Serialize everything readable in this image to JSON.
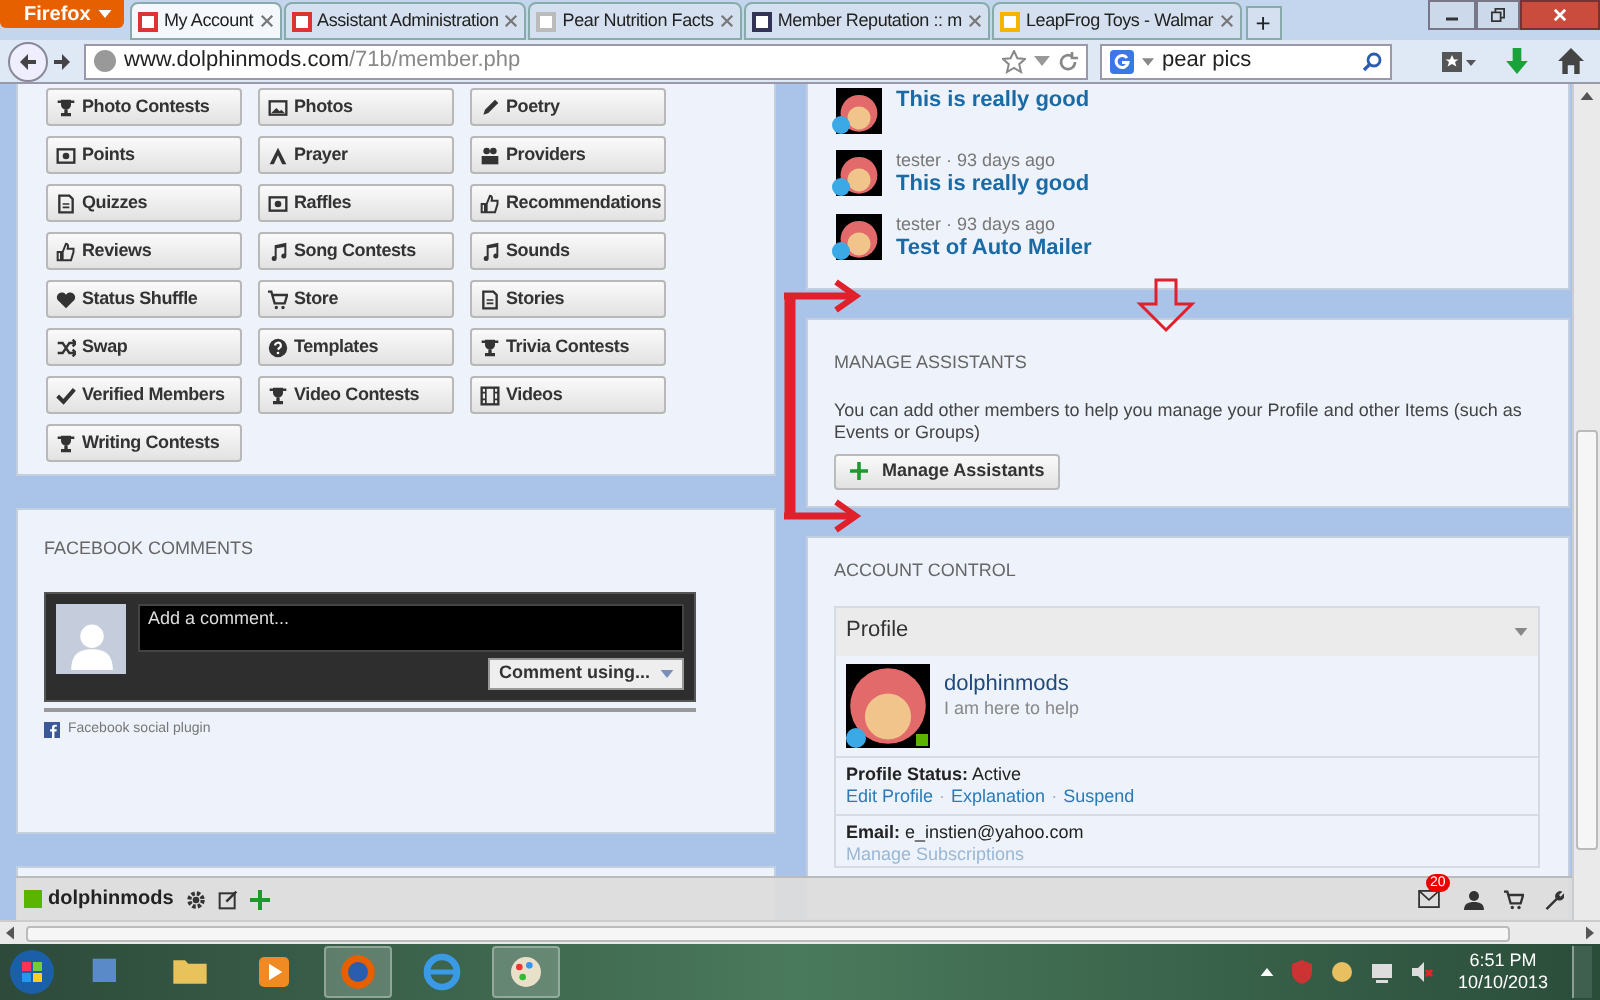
{
  "browser": {
    "menu_button": "Firefox",
    "tabs": [
      {
        "title": "My Account",
        "selected": true
      },
      {
        "title": "Assistant Administration",
        "selected": false
      },
      {
        "title": "Pear Nutrition Facts",
        "selected": false
      },
      {
        "title": "Member Reputation :: m",
        "selected": false
      },
      {
        "title": "LeapFrog Toys - Walmar",
        "selected": false
      }
    ],
    "new_tab": "+",
    "url_host": "www.dolphinmods.com",
    "url_path": "/71b/member.php",
    "search": "pear pics"
  },
  "buttons": [
    "Photo Contests",
    "Photos",
    "Poetry",
    "Points",
    "Prayer",
    "Providers",
    "Quizzes",
    "Raffles",
    "Recommendations",
    "Reviews",
    "Song Contests",
    "Sounds",
    "Status Shuffle",
    "Store",
    "Stories",
    "Swap",
    "Templates",
    "Trivia Contests",
    "Verified Members",
    "Video Contests",
    "Videos",
    "Writing Contests"
  ],
  "facebook": {
    "title": "FACEBOOK COMMENTS",
    "placeholder": "Add a comment...",
    "post_button": "Comment using...",
    "footer": "Facebook social plugin"
  },
  "activity": [
    {
      "title": "This is really good"
    },
    {
      "meta": "tester · 93 days ago",
      "title": "This is really good"
    },
    {
      "meta": "tester · 93 days ago",
      "title": "Test of Auto Mailer"
    }
  ],
  "manage": {
    "title": "MANAGE ASSISTANTS",
    "text": "You can add other members to help you manage your Profile and other Items (such as Events or Groups)",
    "button": "Manage Assistants"
  },
  "account": {
    "title": "ACCOUNT CONTROL",
    "section": "Profile",
    "username": "dolphinmods",
    "tagline": "I am here to help",
    "status_label": "Profile Status:",
    "status": "Active",
    "links": [
      "Edit Profile",
      "Explanation",
      "Suspend"
    ],
    "separator": "·",
    "email_label": "Email:",
    "email": "e_instien@yahoo.com",
    "subscriptions": "Manage Subscriptions"
  },
  "toolbar": {
    "user": "dolphinmods",
    "notifications": "20"
  },
  "taskbar": {
    "time": "6:51 PM",
    "date": "10/10/2013"
  }
}
